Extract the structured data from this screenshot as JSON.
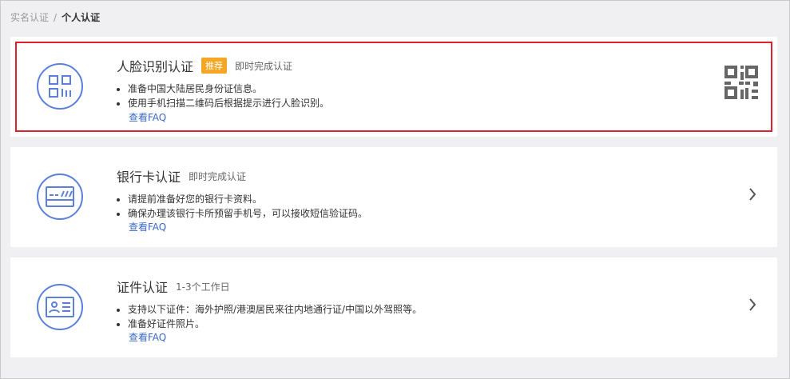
{
  "breadcrumb": {
    "parent": "实名认证",
    "separator": "/",
    "current": "个人认证"
  },
  "cards": [
    {
      "title": "人脸识别认证",
      "tag": "推荐",
      "subtitle": "即时完成认证",
      "bullets": [
        "准备中国大陆居民身份证信息。",
        "使用手机扫描二维码后根据提示进行人脸识别。"
      ],
      "faq": "查看FAQ",
      "action_icon": "qr-code-icon",
      "selected": true
    },
    {
      "title": "银行卡认证",
      "subtitle": "即时完成认证",
      "bullets": [
        "请提前准备好您的银行卡资料。",
        "确保办理该银行卡所预留手机号，可以接收短信验证码。"
      ],
      "faq": "查看FAQ",
      "action_icon": "chevron-right-icon"
    },
    {
      "title": "证件认证",
      "subtitle": "1-3个工作日",
      "bullets": [
        "支持以下证件：海外护照/港澳居民来往内地通行证/中国以外驾照等。",
        "准备好证件照片。"
      ],
      "faq": "查看FAQ",
      "action_icon": "chevron-right-icon"
    }
  ],
  "colors": {
    "accent": "#5b7fdc",
    "tag": "#f5a623",
    "link": "#3a68c8",
    "selection": "#e0202a"
  }
}
